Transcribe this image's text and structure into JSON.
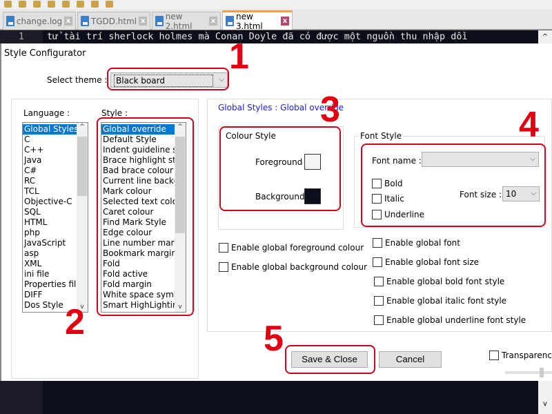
{
  "tabs": [
    {
      "label": "change.log",
      "active": false
    },
    {
      "label": "TGDD.html",
      "active": false
    },
    {
      "label": "new 2.html",
      "active": false
    },
    {
      "label": "new 3.html",
      "active": true
    }
  ],
  "editor": {
    "line_number": "1",
    "line_text": "tử tài trí sherlock holmes mà Conan Doyle đã có được một nguồn thu nhập dồi",
    "background": "#0d0e1b"
  },
  "dialog": {
    "title": "Style Configurator",
    "select_theme_label": "Select theme :",
    "theme_value": "Black board",
    "language_label": "Language :",
    "style_label": "Style :",
    "languages": [
      "Global Styles",
      "C",
      "C++",
      "Java",
      "C#",
      "RC",
      "TCL",
      "Objective-C",
      "SQL",
      "HTML",
      "php",
      "JavaScript",
      "asp",
      "XML",
      "ini file",
      "Properties file",
      "DIFF",
      "Dos Style"
    ],
    "styles": [
      "Global override",
      "Default Style",
      "Indent guideline style",
      "Brace highlight style",
      "Bad brace colour",
      "Current line background colour",
      "Mark colour",
      "Selected text colour",
      "Caret colour",
      "Find Mark Style",
      "Edge colour",
      "Line number margin",
      "Bookmark margin",
      "Fold",
      "Fold active",
      "Fold margin",
      "White space symbol",
      "Smart HighLighting"
    ],
    "selected_language": "Global Styles",
    "selected_style": "Global override",
    "heading": "Global Styles : Global override",
    "colour_style": {
      "title": "Colour Style",
      "foreground_label": "Foreground",
      "foreground_color": "#f5f5f5",
      "background_label": "Background",
      "background_color": "#0d0e1b"
    },
    "font_style": {
      "title": "Font Style",
      "font_name_label": "Font name :",
      "font_name_value": "",
      "bold": "Bold",
      "italic": "Italic",
      "underline": "Underline",
      "font_size_label": "Font size :",
      "font_size_value": "10"
    },
    "enable_checks_left": [
      "Enable global foreground colour",
      "Enable global background colour"
    ],
    "enable_checks_right": [
      "Enable global font",
      "Enable global font size",
      "Enable global bold font style",
      "Enable global italic font style",
      "Enable global underline font style"
    ],
    "save_label": "Save & Close",
    "cancel_label": "Cancel",
    "transparency_label": "Transparency"
  },
  "annotations": [
    "1",
    "2",
    "3",
    "4",
    "5"
  ],
  "colors": {
    "annotation": "#e00012",
    "selection": "#0078d7",
    "heading": "#0000ff"
  }
}
